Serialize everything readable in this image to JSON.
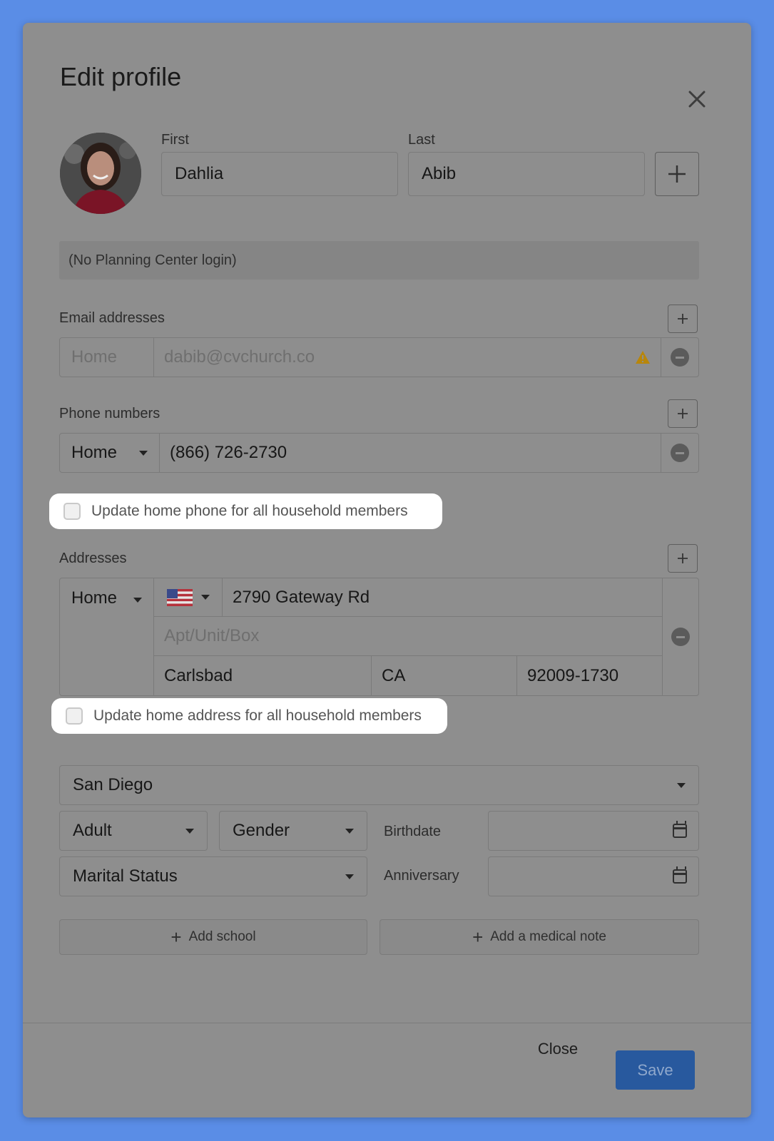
{
  "modal": {
    "title": "Edit profile",
    "close_icon": "close-icon"
  },
  "name": {
    "first_label": "First",
    "first_value": "Dahlia",
    "last_label": "Last",
    "last_value": "Abib",
    "add_icon": "plus-icon"
  },
  "login": {
    "text": "(No Planning Center login)"
  },
  "email": {
    "label": "Email addresses",
    "type_placeholder": "Home",
    "address": "dabib@cvchurch.co",
    "warning_icon": "warning-icon"
  },
  "phone": {
    "label": "Phone numbers",
    "type": "Home",
    "number": "(866) 726-2730",
    "update_all_label": "Update home phone for all household members"
  },
  "address": {
    "label": "Addresses",
    "type": "Home",
    "country_icon": "us-flag-icon",
    "street": "2790 Gateway Rd",
    "apt_placeholder": "Apt/Unit/Box",
    "city": "Carlsbad",
    "state": "CA",
    "zip": "92009-1730",
    "update_all_label": "Update home address for all household members"
  },
  "details": {
    "campus": "San Diego",
    "membership": "Adult",
    "gender": "Gender",
    "birthdate_label": "Birthdate",
    "marital_status": "Marital Status",
    "anniversary_label": "Anniversary",
    "add_school": "Add school",
    "add_medical_note": "Add a medical note"
  },
  "footer": {
    "close_label": "Close",
    "save_label": "Save"
  },
  "colors": {
    "page_background": "#5a8de6",
    "overlay_panel": "#8e8e8e",
    "save_button": "#28599e",
    "warning": "#b8860b"
  }
}
